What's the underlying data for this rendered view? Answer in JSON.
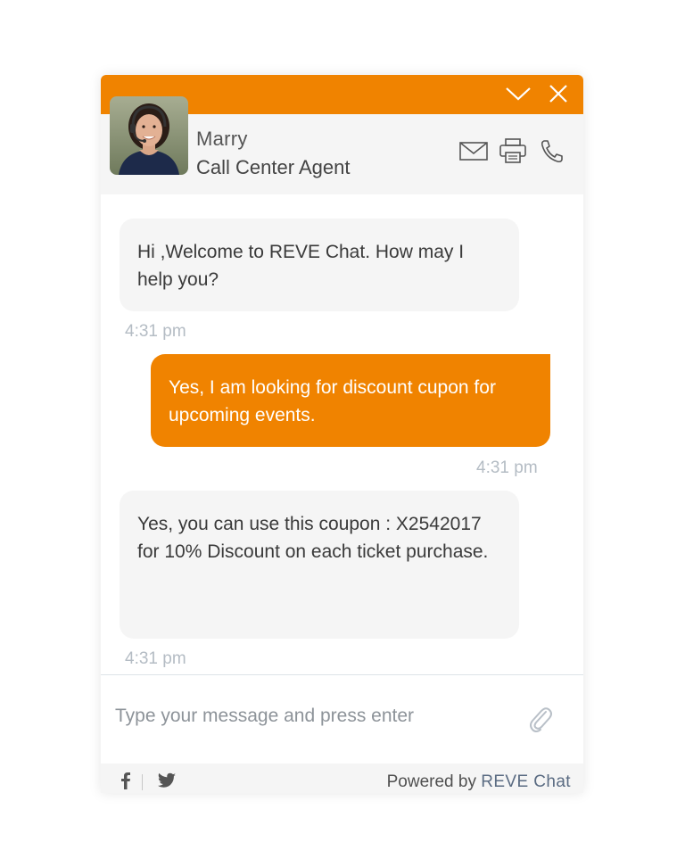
{
  "header": {
    "minimize_icon": "chevron-down-icon",
    "close_icon": "close-icon",
    "accent_color": "#f08300"
  },
  "agent": {
    "name": "Marry",
    "role": "Call Center Agent",
    "actions": [
      "email-icon",
      "print-icon",
      "phone-icon"
    ]
  },
  "messages": [
    {
      "sender": "agent",
      "text": "Hi ,Welcome to REVE Chat. How may I help you?",
      "time": "4:31 pm"
    },
    {
      "sender": "user",
      "text": "Yes, I am looking for discount cupon for upcoming events.",
      "time": "4:31 pm"
    },
    {
      "sender": "agent",
      "text": "Yes, you can use this coupon : X2542017 for 10% Discount on each ticket purchase.",
      "time": "4:31 pm"
    }
  ],
  "composer": {
    "placeholder": "Type your message and press enter",
    "value": "",
    "attach_icon": "paperclip-icon"
  },
  "footer": {
    "social": [
      "facebook-icon",
      "twitter-icon"
    ],
    "powered_by": "Powered by",
    "brand": "REVE Chat"
  }
}
